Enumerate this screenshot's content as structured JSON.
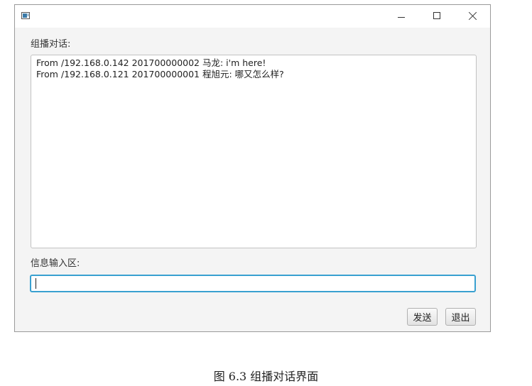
{
  "window": {
    "icon": "app-window-icon",
    "controls": {
      "minimize": "minimize-icon",
      "maximize": "maximize-icon",
      "close": "close-icon"
    }
  },
  "chat": {
    "label": "组播对话:",
    "messages": [
      "From /192.168.0.142 201700000002 马龙: i'm here!",
      "From /192.168.0.121 201700000001 程旭元: 哪又怎么样?"
    ]
  },
  "input": {
    "label": "信息输入区:",
    "value": ""
  },
  "buttons": {
    "send": "发送",
    "exit": "退出"
  },
  "caption": "图 6.3  组播对话界面",
  "colors": {
    "focus_border": "#39a0d0",
    "window_bg": "#f4f4f4"
  }
}
